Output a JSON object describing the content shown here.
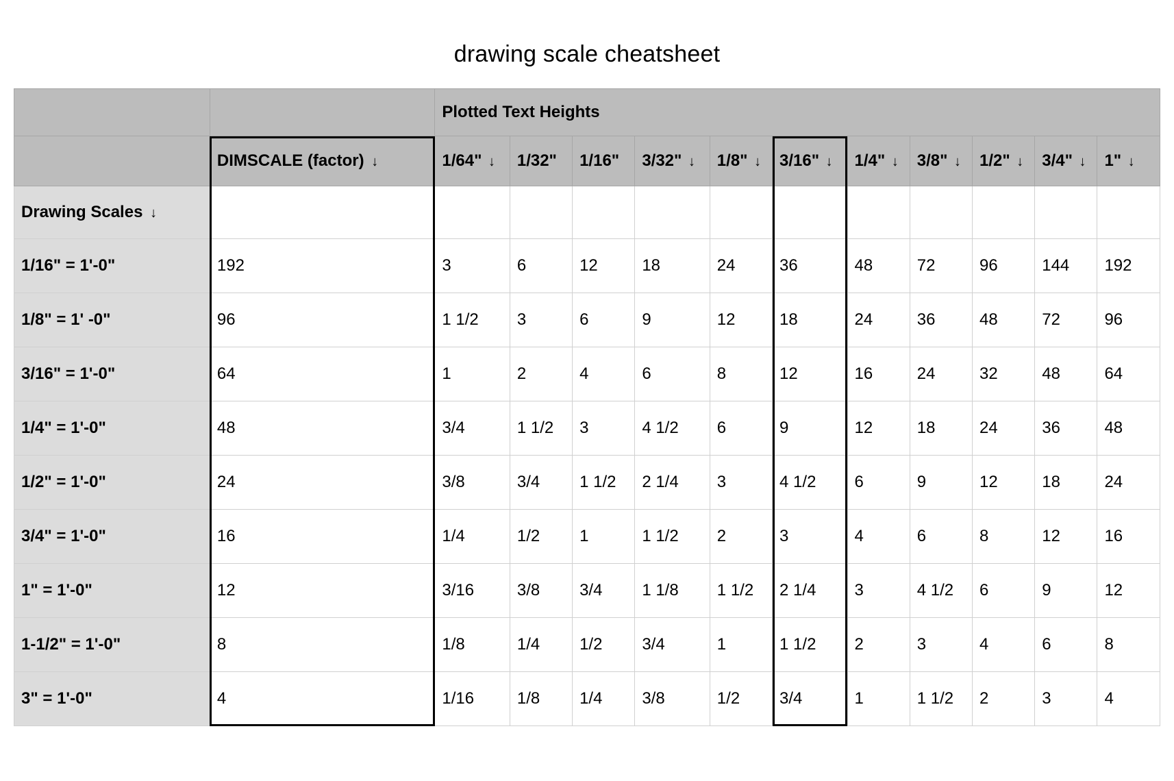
{
  "title": "drawing scale cheatsheet",
  "header_group_label": "Plotted Text Heights",
  "dimscale_header": "DIMSCALE (factor)",
  "drawing_scales_header": "Drawing Scales",
  "sort_glyph": "↓",
  "text_height_headers": [
    "1/64\"",
    "1/32\"",
    "1/16\"",
    "3/32\"",
    "1/8\"",
    "3/16\"",
    "1/4\"",
    "3/8\"",
    "1/2\"",
    "3/4\"",
    "1\""
  ],
  "header_has_arrow": [
    true,
    false,
    false,
    true,
    true,
    true,
    true,
    true,
    true,
    true,
    true
  ],
  "rows": [
    {
      "scale": "1/16\" = 1'-0\"",
      "dimscale": "192",
      "values": [
        "3",
        "6",
        "12",
        "18",
        "24",
        "36",
        "48",
        "72",
        "96",
        "144",
        "192"
      ]
    },
    {
      "scale": "1/8\" = 1' -0\"",
      "dimscale": "96",
      "values": [
        "1 1/2",
        "3",
        "6",
        "9",
        "12",
        "18",
        "24",
        "36",
        "48",
        "72",
        "96"
      ]
    },
    {
      "scale": "3/16\" = 1'-0\"",
      "dimscale": "64",
      "values": [
        "1",
        "2",
        "4",
        "6",
        "8",
        "12",
        "16",
        "24",
        "32",
        "48",
        "64"
      ]
    },
    {
      "scale": "1/4\" = 1'-0\"",
      "dimscale": "48",
      "values": [
        "3/4",
        "1 1/2",
        "3",
        "4 1/2",
        "6",
        "9",
        "12",
        "18",
        "24",
        "36",
        "48"
      ]
    },
    {
      "scale": "1/2\" = 1'-0\"",
      "dimscale": "24",
      "values": [
        "3/8",
        "3/4",
        "1 1/2",
        "2 1/4",
        "3",
        "4 1/2",
        "6",
        "9",
        "12",
        "18",
        "24"
      ]
    },
    {
      "scale": "3/4\" = 1'-0\"",
      "dimscale": "16",
      "values": [
        "1/4",
        "1/2",
        "1",
        "1 1/2",
        "2",
        "3",
        "4",
        "6",
        "8",
        "12",
        "16"
      ]
    },
    {
      "scale": "1\" = 1'-0\"",
      "dimscale": "12",
      "values": [
        "3/16",
        "3/8",
        "3/4",
        "1 1/8",
        "1 1/2",
        "2 1/4",
        "3",
        "4 1/2",
        "6",
        "9",
        "12"
      ]
    },
    {
      "scale": "1-1/2\" = 1'-0\"",
      "dimscale": "8",
      "values": [
        "1/8",
        "1/4",
        "1/2",
        "3/4",
        "1",
        "1 1/2",
        "2",
        "3",
        "4",
        "6",
        "8"
      ]
    },
    {
      "scale": "3\" = 1'-0\"",
      "dimscale": "4",
      "values": [
        "1/16",
        "1/8",
        "1/4",
        "3/8",
        "1/2",
        "3/4",
        "1",
        "1 1/2",
        "2",
        "3",
        "4"
      ]
    }
  ],
  "highlight_columns": {
    "dimscale": true,
    "text_height_index": 5
  },
  "chart_data": {
    "type": "table",
    "title": "drawing scale cheatsheet",
    "row_labels_title": "Drawing Scales",
    "row_labels": [
      "1/16\" = 1'-0\"",
      "1/8\" = 1'-0\"",
      "3/16\" = 1'-0\"",
      "1/4\" = 1'-0\"",
      "1/2\" = 1'-0\"",
      "3/4\" = 1'-0\"",
      "1\" = 1'-0\"",
      "1-1/2\" = 1'-0\"",
      "3\" = 1'-0\""
    ],
    "columns": [
      "DIMSCALE (factor)",
      "1/64\"",
      "1/32\"",
      "1/16\"",
      "3/32\"",
      "1/8\"",
      "3/16\"",
      "1/4\"",
      "3/8\"",
      "1/2\"",
      "3/4\"",
      "1\""
    ],
    "column_group": "Plotted Text Heights",
    "data": [
      [
        "192",
        "3",
        "6",
        "12",
        "18",
        "24",
        "36",
        "48",
        "72",
        "96",
        "144",
        "192"
      ],
      [
        "96",
        "1 1/2",
        "3",
        "6",
        "9",
        "12",
        "18",
        "24",
        "36",
        "48",
        "72",
        "96"
      ],
      [
        "64",
        "1",
        "2",
        "4",
        "6",
        "8",
        "12",
        "16",
        "24",
        "32",
        "48",
        "64"
      ],
      [
        "48",
        "3/4",
        "1 1/2",
        "3",
        "4 1/2",
        "6",
        "9",
        "12",
        "18",
        "24",
        "36",
        "48"
      ],
      [
        "24",
        "3/8",
        "3/4",
        "1 1/2",
        "2 1/4",
        "3",
        "4 1/2",
        "6",
        "9",
        "12",
        "18",
        "24"
      ],
      [
        "16",
        "1/4",
        "1/2",
        "1",
        "1 1/2",
        "2",
        "3",
        "4",
        "6",
        "8",
        "12",
        "16"
      ],
      [
        "12",
        "3/16",
        "3/8",
        "3/4",
        "1 1/8",
        "1 1/2",
        "2 1/4",
        "3",
        "4 1/2",
        "6",
        "9",
        "12"
      ],
      [
        "8",
        "1/8",
        "1/4",
        "1/2",
        "3/4",
        "1",
        "1 1/2",
        "2",
        "3",
        "4",
        "6",
        "8"
      ],
      [
        "4",
        "1/16",
        "1/8",
        "1/4",
        "3/8",
        "1/2",
        "3/4",
        "1",
        "1 1/2",
        "2",
        "3",
        "4"
      ]
    ]
  }
}
